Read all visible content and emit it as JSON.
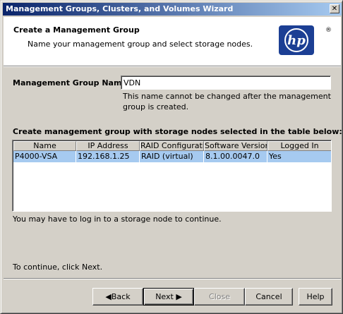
{
  "window": {
    "title": "Management Groups, Clusters, and Volumes Wizard",
    "close_glyph": "✕"
  },
  "header": {
    "title": "Create a Management Group",
    "subtitle": "Name your management group and select storage nodes.",
    "logo_text": "hp",
    "logo_registered": "®",
    "brand_color": "#1c3f94"
  },
  "form": {
    "mg_name_label": "Management Group Name:",
    "mg_name_value": "VDN",
    "mg_name_note": "This name cannot be changed after the management group is created."
  },
  "table": {
    "label": "Create management group with storage nodes selected in the table below:",
    "columns": [
      "Name",
      "IP Address",
      "RAID Configurati...",
      "Software Version",
      "Logged In"
    ],
    "rows": [
      [
        "P4000-VSA",
        "192.168.1.25",
        "RAID (virtual)",
        "8.1.00.0047.0",
        "Yes"
      ]
    ],
    "selected_color": "#a6caf0"
  },
  "notes": {
    "login": "You may have to log in to a storage node to continue.",
    "continue": "To continue, click Next."
  },
  "buttons": {
    "back": "Back",
    "next": "Next",
    "close": "Close",
    "cancel": "Cancel",
    "help": "Help"
  }
}
